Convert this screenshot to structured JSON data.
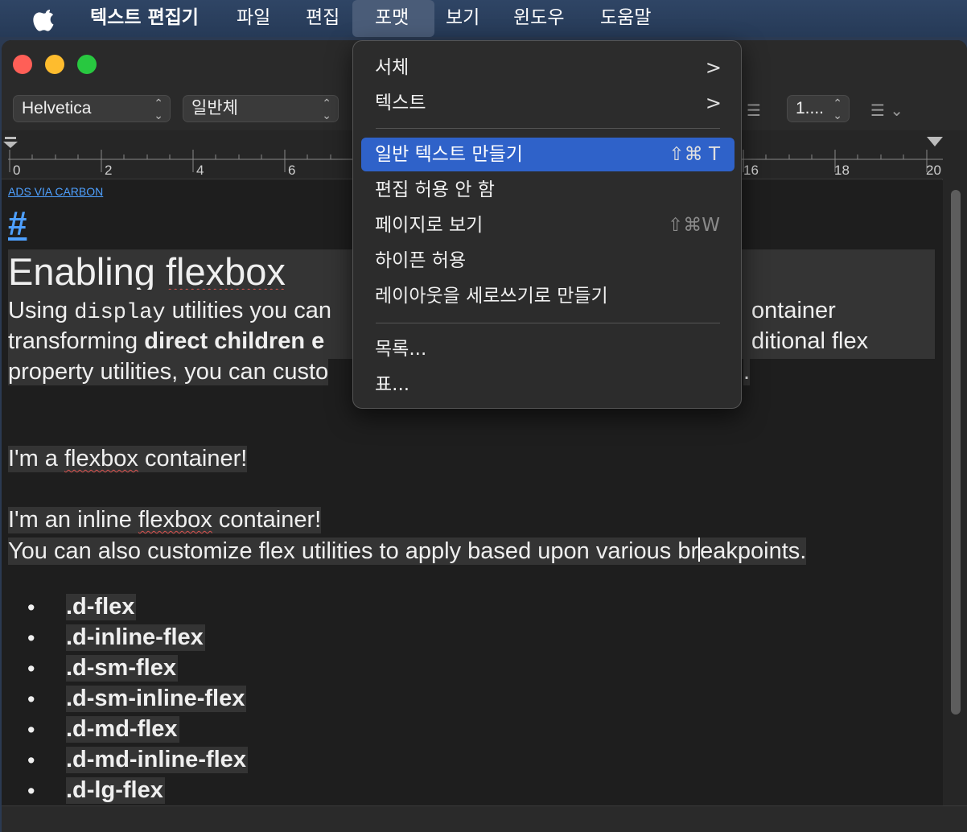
{
  "menubar": {
    "app_name": "텍스트 편집기",
    "items": [
      "파일",
      "편집",
      "포맷",
      "보기",
      "윈도우",
      "도움말"
    ],
    "active": "포맷"
  },
  "toolbar": {
    "font_family": "Helvetica",
    "font_style": "일반체",
    "line_spacing": "1...."
  },
  "ruler": {
    "labels": [
      "0",
      "2",
      "4",
      "6",
      "16",
      "18",
      "20"
    ]
  },
  "document": {
    "ads": "ADS VIA CARBON",
    "hash": "#",
    "heading_a": "Enabling ",
    "heading_b": "flexbox",
    "para1_a": "Using ",
    "para1_code": "display",
    "para1_b": " utilities you can",
    "para1_c": "ontainer",
    "para2_a": "transforming ",
    "para2_b": "direct children e",
    "para2_c": "ditional flex",
    "para3_a": "property utilities, you can custo",
    "para3_c": ".",
    "line1_a": "I'm a ",
    "line1_b": "flexbox",
    "line1_c": " container!",
    "line2_a": "I'm an inline ",
    "line2_b": "flexbox",
    "line2_c": " container!",
    "line3_a": "You can also customize flex utilities to apply based upon various br",
    "line3_b": "eakpoints.",
    "bullets": [
      ".d-flex",
      ".d-inline-flex",
      ".d-sm-flex",
      ".d-sm-inline-flex",
      ".d-md-flex",
      ".d-md-inline-flex",
      ".d-lg-flex"
    ]
  },
  "format_menu": {
    "font": "서체",
    "text": "텍스트",
    "make_plain_text": "일반 텍스트 만들기",
    "make_plain_text_shortcut": "⇧⌘ T",
    "prevent_editing": "편집 허용 안 함",
    "wrap_to_page": "페이지로 보기",
    "wrap_to_page_shortcut": "⇧⌘W",
    "allow_hyphenation": "하이픈 허용",
    "vertical_layout": "레이아웃을 세로쓰기로 만들기",
    "list": "목록...",
    "table": "표..."
  }
}
